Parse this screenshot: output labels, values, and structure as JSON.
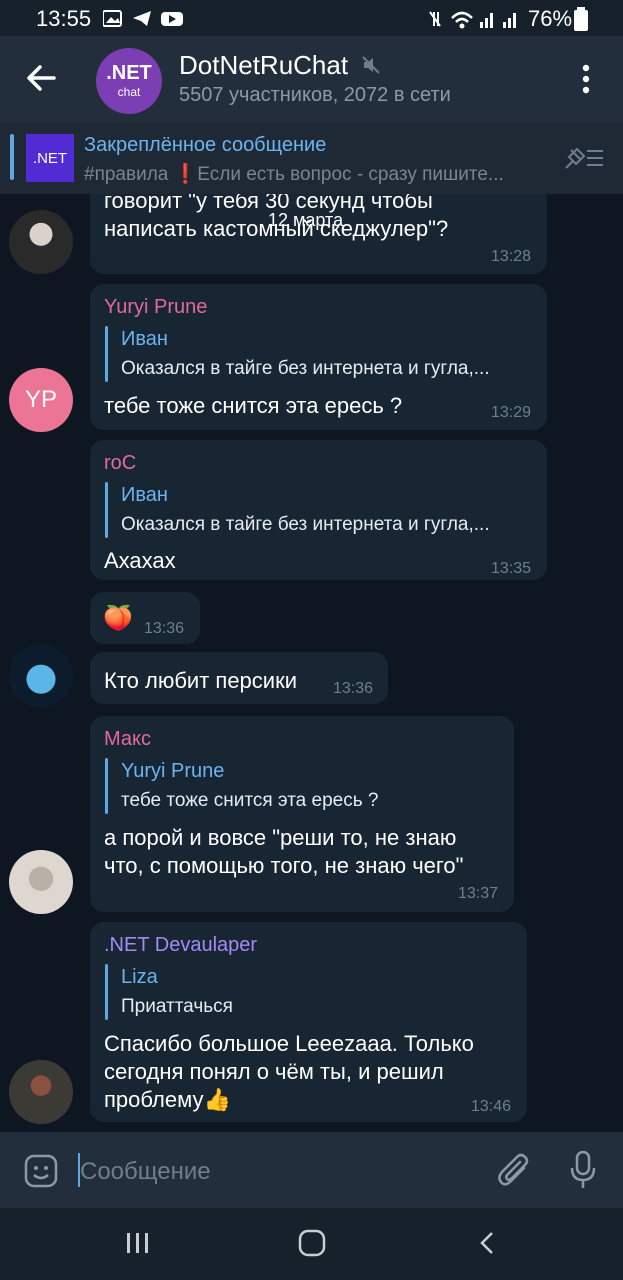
{
  "status_bar": {
    "time": "13:55",
    "battery": "76%"
  },
  "header": {
    "title": "DotNetRuChat",
    "subtitle": "5507 участников, 2072 в сети",
    "avatar_line1": ".NET",
    "avatar_line2": "chat"
  },
  "pinned": {
    "title": "Закреплённое сообщение",
    "text": "#правила ❗Если есть вопрос - сразу пишите...",
    "thumb_label": ".NET"
  },
  "date_badge": "12 марта",
  "messages": [
    {
      "text_line1": "говорит \"у тебя 30 секунд чтобы",
      "text_line2": "написать кастомный скеджулер\"?",
      "time": "13:28"
    },
    {
      "initials": "YP",
      "sender": "Yuryi Prune",
      "reply_name": "Иван",
      "reply_text": "Оказался в тайге без интернета и гугла,...",
      "text": "тебе тоже снится эта ересь ?",
      "time": "13:29"
    },
    {
      "sender": "roC",
      "reply_name": "Иван",
      "reply_text": "Оказался в тайге без интернета и гугла,...",
      "text": "Ахахах",
      "time": "13:35"
    },
    {
      "emoji": "🍑",
      "time": "13:36"
    },
    {
      "text": "Кто любит персики",
      "time": "13:36"
    },
    {
      "sender": "Макс",
      "reply_name": "Yuryi Prune",
      "reply_text": "тебе тоже снится эта ересь ?",
      "text_line1": "а порой и вовсе \"реши то, не знаю",
      "text_line2": "что, с помощью того, не знаю чего\"",
      "time": "13:37"
    },
    {
      "sender": ".NET Devaulaper",
      "reply_name": "Liza",
      "reply_text": "Приаттачься",
      "text_line1": "Спасибо большое Leeezaaa. Только",
      "text_line2": "сегодня понял о чём ты, и решил",
      "text_line3": "проблему👍",
      "time": "13:46"
    }
  ],
  "composer": {
    "placeholder": "Сообщение"
  },
  "colors": {
    "accent": "#5fa8e0",
    "name_pink": "#e36a9a",
    "name_purple": "#a58af5",
    "bg": "#0e1621",
    "bubble": "#182533"
  }
}
